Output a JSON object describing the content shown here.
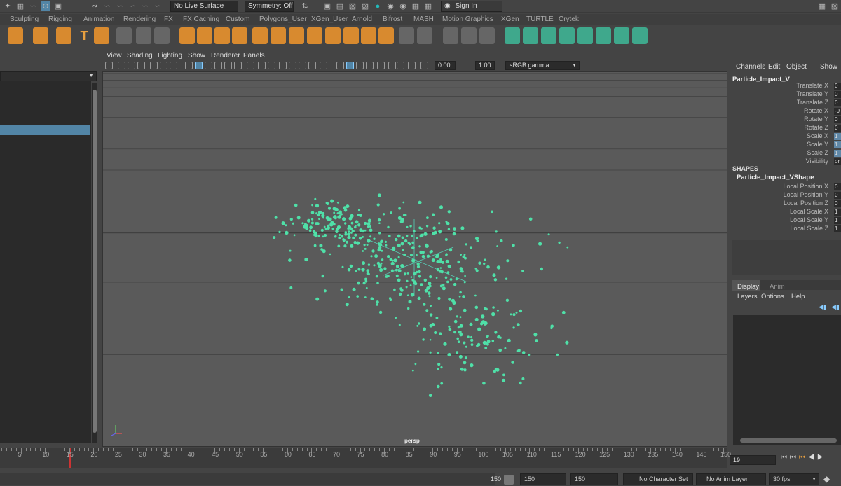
{
  "topbar": {
    "live_surface": "No Live Surface",
    "symmetry": "Symmetry: Off",
    "sign_in": "Sign In"
  },
  "shelf_tabs": [
    "Sculpting",
    "Rigging",
    "Animation",
    "Rendering",
    "FX",
    "FX Caching",
    "Custom",
    "Polygons_User",
    "XGen_User",
    "Arnold",
    "Bifrost",
    "MASH",
    "Motion Graphics",
    "XGen",
    "TURTLE",
    "Crytek"
  ],
  "viewport": {
    "menus": [
      "View",
      "Shading",
      "Lighting",
      "Show",
      "Renderer",
      "Panels"
    ],
    "exposure": "0.00",
    "gamma": "1.00",
    "colorspace": "sRGB gamma",
    "camera_label": "persp"
  },
  "channel_box": {
    "menus": [
      "Channels",
      "Edit",
      "Object",
      "Show"
    ],
    "object_name": "Particle_Impact_V",
    "attributes": [
      {
        "label": "Translate X",
        "value": "0",
        "highlight": false
      },
      {
        "label": "Translate Y",
        "value": "0",
        "highlight": false
      },
      {
        "label": "Translate Z",
        "value": "0",
        "highlight": false
      },
      {
        "label": "Rotate X",
        "value": "-9",
        "highlight": false
      },
      {
        "label": "Rotate Y",
        "value": "0",
        "highlight": false
      },
      {
        "label": "Rotate Z",
        "value": "0",
        "highlight": false
      },
      {
        "label": "Scale X",
        "value": "1",
        "highlight": true
      },
      {
        "label": "Scale Y",
        "value": "1",
        "highlight": true
      },
      {
        "label": "Scale Z",
        "value": "1",
        "highlight": true
      },
      {
        "label": "Visibility",
        "value": "or",
        "highlight": false
      }
    ],
    "shapes_header": "SHAPES",
    "shape_name": "Particle_Impact_VShape",
    "shape_attributes": [
      {
        "label": "Local Position X",
        "value": "0"
      },
      {
        "label": "Local Position Y",
        "value": "0"
      },
      {
        "label": "Local Position Z",
        "value": "0"
      },
      {
        "label": "Local Scale X",
        "value": "1"
      },
      {
        "label": "Local Scale Y",
        "value": "1"
      },
      {
        "label": "Local Scale Z",
        "value": "1"
      }
    ]
  },
  "layer_editor": {
    "tabs": [
      "Display",
      "Anim"
    ],
    "menus": [
      "Layers",
      "Options",
      "Help"
    ]
  },
  "timeline": {
    "ticks": [
      "5",
      "10",
      "15",
      "20",
      "25",
      "30",
      "35",
      "40",
      "45",
      "50",
      "55",
      "60",
      "65",
      "70",
      "75",
      "80",
      "85",
      "90",
      "95",
      "100",
      "105",
      "110",
      "115",
      "120",
      "125",
      "130",
      "135",
      "140",
      "145",
      "150"
    ],
    "current_frame": "19"
  },
  "statusbar": {
    "range_end_a": "150",
    "range_end_b": "150",
    "range_end_c": "150",
    "character_set": "No Character Set",
    "anim_layer": "No Anim Layer",
    "fps": "30 fps"
  }
}
